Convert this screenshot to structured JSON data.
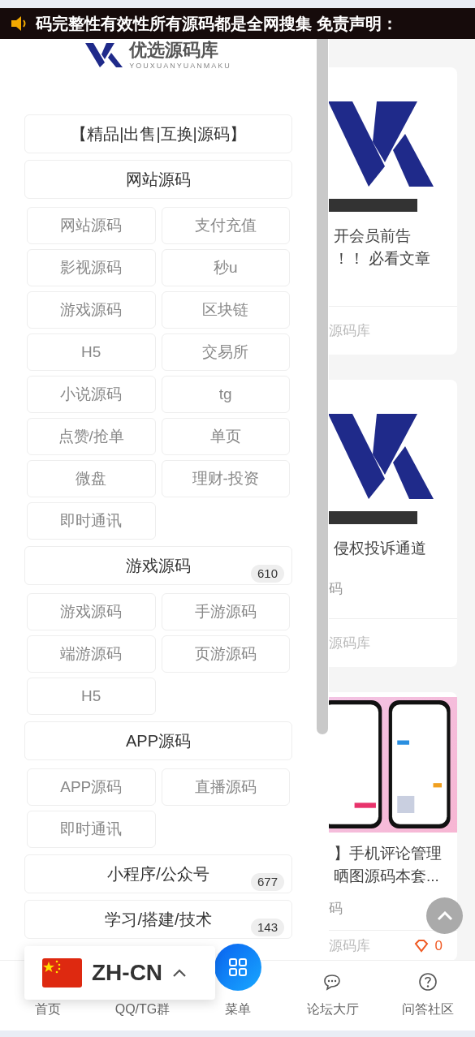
{
  "notice": {
    "text": "码完整性有效性所有源码都是全网搜集 免责声明："
  },
  "drawer": {
    "logo": {
      "name": "优选源码库",
      "subtitle": "YOUXUANYUANMAKU"
    },
    "categories": [
      {
        "label": "【精品|出售|互换|源码】"
      },
      {
        "label": "网站源码",
        "children": [
          "网站源码",
          "支付充值",
          "影视源码",
          "秒u",
          "游戏源码",
          "区块链",
          "H5",
          "交易所",
          "小说源码",
          "tg",
          "点赞/抢单",
          "单页",
          "微盘",
          "理财-投资",
          "即时通讯"
        ]
      },
      {
        "label": "游戏源码",
        "count": "610",
        "children": [
          "游戏源码",
          "手游源码",
          "端游源码",
          "页游源码",
          "H5"
        ]
      },
      {
        "label": "APP源码",
        "children": [
          "APP源码",
          "直播源码",
          "即时通讯"
        ]
      },
      {
        "label": "小程序/公众号",
        "count": "677"
      },
      {
        "label": "学习/搭建/技术",
        "count": "143"
      }
    ]
  },
  "cards": [
    {
      "kind": "logo",
      "lines": [
        "开会员前告",
        "！！ 必看文章"
      ],
      "footer": "源码库"
    },
    {
      "kind": "logo",
      "lines": [
        "侵权投诉通道"
      ],
      "meta": "码",
      "footer": "源码库"
    },
    {
      "kind": "screenshot",
      "lines": [
        "】手机评论管理",
        "晒图源码本套..."
      ],
      "meta": "码",
      "footer": "源码库",
      "count": "0"
    }
  ],
  "language": {
    "code": "ZH-CN"
  },
  "nav": [
    {
      "label": "首页",
      "kind": "covered"
    },
    {
      "label": "QQ/TG群",
      "kind": "covered"
    },
    {
      "label": "菜单",
      "kind": "menu"
    },
    {
      "label": "论坛大厅",
      "kind": "chat"
    },
    {
      "label": "问答社区",
      "kind": "help"
    }
  ]
}
